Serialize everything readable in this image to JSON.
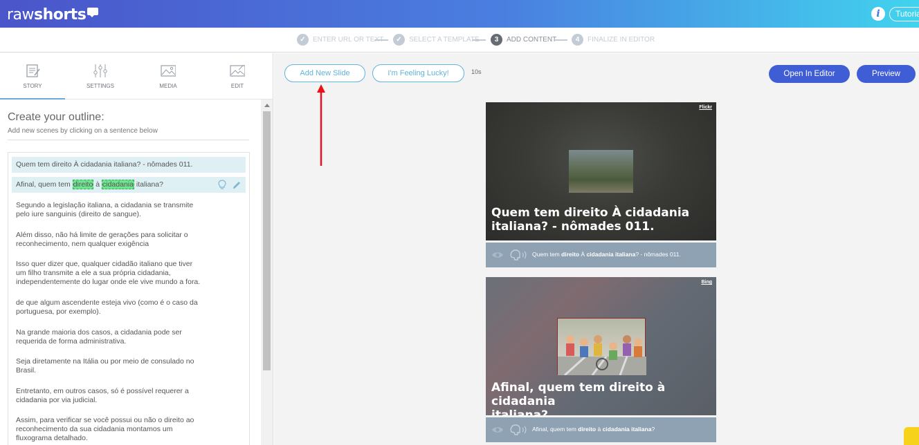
{
  "app": {
    "logo_light": "raw",
    "logo_bold": "shorts",
    "info_label": "i",
    "tutorial_label": "Tutorial",
    "brand_colors": {
      "gradient_start": "#4a55c9",
      "gradient_end": "#41d3ee",
      "primary_button": "#3f5ed6",
      "accent_outline": "#5fb3d8",
      "highlight": "#6fe58f"
    }
  },
  "steps": [
    {
      "number": "✓",
      "label": "ENTER URL OR TEXT",
      "state": "done"
    },
    {
      "number": "✓",
      "label": "SELECT A TEMPLATE",
      "state": "done"
    },
    {
      "number": "3",
      "label": "ADD CONTENT",
      "state": "active"
    },
    {
      "number": "4",
      "label": "FINALIZE IN EDITOR",
      "state": "pending"
    }
  ],
  "tabs": [
    {
      "label": "STORY",
      "icon": "story-icon",
      "active": true
    },
    {
      "label": "SETTINGS",
      "icon": "sliders-icon",
      "active": false
    },
    {
      "label": "MEDIA",
      "icon": "image-icon",
      "active": false
    },
    {
      "label": "EDIT",
      "icon": "edit-image-icon",
      "active": false
    }
  ],
  "outline": {
    "title": "Create your outline:",
    "subtitle": "Add new scenes by clicking on a sentence below",
    "sentences": [
      {
        "text": "Quem tem direito À cidadania italiana? - nômades 011."
      },
      {
        "pre": "Afinal, quem tem ",
        "hl1": "direito",
        "mid": " à ",
        "hl2": "cidadania",
        "post": " italiana?"
      },
      {
        "line1": "Segundo a legislação italiana, a cidadania se transmite",
        "line2": "pelo iure sanguinis (direito de sangue)."
      },
      {
        "line1": "Além disso, não há limite de gerações para solicitar o",
        "line2": "reconhecimento, nem qualquer exigência"
      },
      {
        "line1": "Isso quer dizer que, qualquer cidadão italiano que tiver",
        "line2": "um filho transmite a ele a sua própria cidadania,",
        "line3": "independentemente do lugar onde ele vive mundo a fora."
      },
      {
        "line1": "de que algum ascendente esteja vivo (como é o caso da",
        "line2": "portuguesa, por exemplo)."
      },
      {
        "line1": "Na grande maioria dos casos, a cidadania pode ser",
        "line2": "requerida de forma administrativa."
      },
      {
        "line1": "Seja diretamente na Itália ou por meio de consulado no",
        "line2": "Brasil."
      },
      {
        "line1": "Entretanto, em outros casos, só é possível requerer a",
        "line2": "cidadania por via judicial."
      },
      {
        "line1": "Assim, para verificar se você possui ou não o direito ao",
        "line2": "reconhecimento da sua cidadania montamos um",
        "line3": "fluxograma detalhado."
      }
    ]
  },
  "toolbar": {
    "add_slide": "Add New Slide",
    "lucky": "I'm Feeling Lucky!",
    "duration": "10s",
    "open_editor": "Open In Editor",
    "preview": "Preview"
  },
  "slides": [
    {
      "source": "Flickr",
      "title_line1": "Quem tem direito À cidadania",
      "title_line2": "italiana? - nômades 011.",
      "cap_pre": "Quem tem ",
      "cap_b1": "direito",
      "cap_mid": " À ",
      "cap_b2": "cidadania italiana",
      "cap_post": "? - nômades 011."
    },
    {
      "source": "Bing",
      "title_line1": "Afinal, quem tem direito à cidadania",
      "title_line2": "italiana?",
      "cap_pre": "Afinal, quem tem ",
      "cap_b1": "direito",
      "cap_mid": " à ",
      "cap_b2": "cidadania italiana",
      "cap_post": "?"
    }
  ]
}
